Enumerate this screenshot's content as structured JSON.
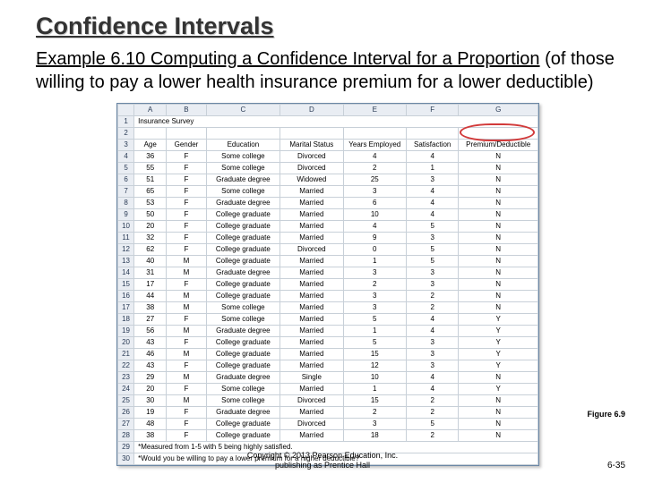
{
  "title": "Confidence Intervals",
  "example_label": "Example 6.10  Computing a Confidence Interval for a Proportion",
  "example_rest": " (of those willing to pay a lower health insurance premium for a lower deductible)",
  "survey_title": "Insurance Survey",
  "columns": [
    "",
    "A",
    "B",
    "C",
    "D",
    "E",
    "F",
    "G"
  ],
  "header_row": [
    "",
    "Age",
    "Gender",
    "Education",
    "Marital Status",
    "Years Employed",
    "Satisfaction",
    "Premium/Deductible"
  ],
  "rows": [
    [
      "4",
      "36",
      "F",
      "Some college",
      "Divorced",
      "4",
      "4",
      "N"
    ],
    [
      "5",
      "55",
      "F",
      "Some college",
      "Divorced",
      "2",
      "1",
      "N"
    ],
    [
      "6",
      "51",
      "F",
      "Graduate degree",
      "Widowed",
      "25",
      "3",
      "N"
    ],
    [
      "7",
      "65",
      "F",
      "Some college",
      "Married",
      "3",
      "4",
      "N"
    ],
    [
      "8",
      "53",
      "F",
      "Graduate degree",
      "Married",
      "6",
      "4",
      "N"
    ],
    [
      "9",
      "50",
      "F",
      "College graduate",
      "Married",
      "10",
      "4",
      "N"
    ],
    [
      "10",
      "20",
      "F",
      "College graduate",
      "Married",
      "4",
      "5",
      "N"
    ],
    [
      "11",
      "32",
      "F",
      "College graduate",
      "Married",
      "9",
      "3",
      "N"
    ],
    [
      "12",
      "62",
      "F",
      "College graduate",
      "Divorced",
      "0",
      "5",
      "N"
    ],
    [
      "13",
      "40",
      "M",
      "College graduate",
      "Married",
      "1",
      "5",
      "N"
    ],
    [
      "14",
      "31",
      "M",
      "Graduate degree",
      "Married",
      "3",
      "3",
      "N"
    ],
    [
      "15",
      "17",
      "F",
      "College graduate",
      "Married",
      "2",
      "3",
      "N"
    ],
    [
      "16",
      "44",
      "M",
      "College graduate",
      "Married",
      "3",
      "2",
      "N"
    ],
    [
      "17",
      "38",
      "M",
      "Some college",
      "Married",
      "3",
      "2",
      "N"
    ],
    [
      "18",
      "27",
      "F",
      "Some college",
      "Married",
      "5",
      "4",
      "Y"
    ],
    [
      "19",
      "56",
      "M",
      "Graduate degree",
      "Married",
      "1",
      "4",
      "Y"
    ],
    [
      "20",
      "43",
      "F",
      "College graduate",
      "Married",
      "5",
      "3",
      "Y"
    ],
    [
      "21",
      "46",
      "M",
      "College graduate",
      "Married",
      "15",
      "3",
      "Y"
    ],
    [
      "22",
      "43",
      "F",
      "College graduate",
      "Married",
      "12",
      "3",
      "Y"
    ],
    [
      "23",
      "29",
      "M",
      "Graduate degree",
      "Single",
      "10",
      "4",
      "N"
    ],
    [
      "24",
      "20",
      "F",
      "Some college",
      "Married",
      "1",
      "4",
      "Y"
    ],
    [
      "25",
      "30",
      "M",
      "Some college",
      "Divorced",
      "15",
      "2",
      "N"
    ],
    [
      "26",
      "19",
      "F",
      "Graduate degree",
      "Married",
      "2",
      "2",
      "N"
    ],
    [
      "27",
      "48",
      "F",
      "College graduate",
      "Divorced",
      "3",
      "5",
      "N"
    ],
    [
      "28",
      "38",
      "F",
      "College graduate",
      "Married",
      "18",
      "2",
      "N"
    ]
  ],
  "footnotes": [
    "*Measured from 1-5 with 5 being highly satisfied.",
    "*Would you be willing to pay a lower premium for a higher deductible?"
  ],
  "figure_label": "Figure 6.9",
  "copyright_l1": "Copyright © 2013 Pearson Education, Inc.",
  "copyright_l2": "publishing as Prentice Hall",
  "page_number": "6-35"
}
